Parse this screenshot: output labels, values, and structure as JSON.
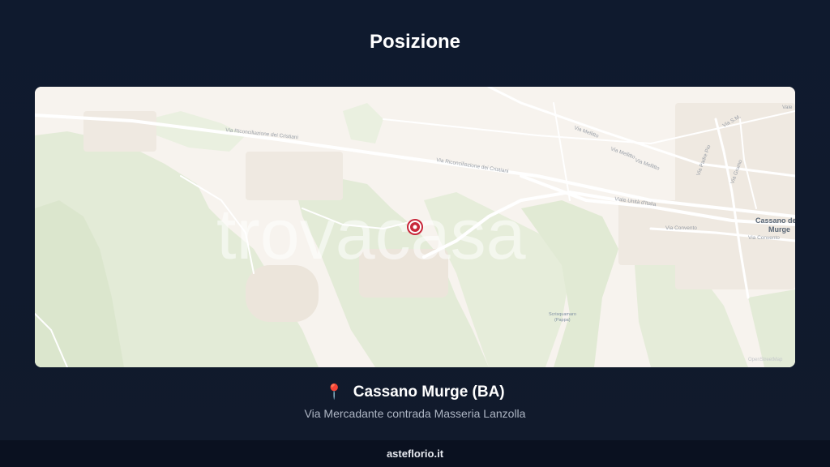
{
  "header": {
    "title": "Posizione"
  },
  "map": {
    "watermark": "trovacasa",
    "roads": {
      "riconciliazione_1": "Via Riconciliazione dei Cristiani",
      "riconciliazione_2": "Via Riconciliazione dei Cristiani",
      "mellitto_1": "Via Mellitto",
      "mellitto_2": "Via Mellitto",
      "mellitto_3": "Via Mellitto",
      "unita_italia": "Viale Unità d'Italia",
      "convento_1": "Via Convento",
      "convento_2": "Via Convento",
      "grumo": "Via Grumo",
      "padre_pio": "Via Padre Pio",
      "sp": "Via S.M.",
      "vale": "Vale"
    },
    "places": {
      "town_line1": "Cassano de",
      "town_line2": "Murge",
      "poi_line1": "Scrisquamaro",
      "poi_line2": "(Pappa)"
    },
    "attribution": "OpenStreetMap",
    "colors": {
      "land": "#f7f3ee",
      "park": "#e4ecd8",
      "park_dark": "#dbe7cd",
      "road": "#ffffff",
      "marker": "#c8273a"
    }
  },
  "location": {
    "icon": "pin-icon",
    "name": "Cassano Murge (BA)",
    "address": "Via Mercadante contrada Masseria Lanzolla"
  },
  "footer": {
    "site": "asteflorio.it"
  }
}
